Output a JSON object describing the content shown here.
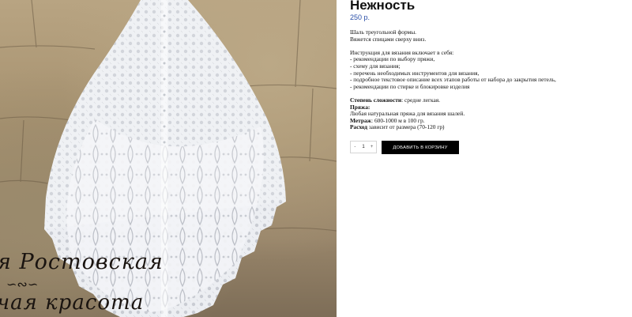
{
  "product": {
    "title": "Нежность",
    "price": "250 р.",
    "image_alt": "Шаль треугольной формы",
    "watermark_line1": "я Ростовская",
    "watermark_line2": "чая красота"
  },
  "description": {
    "intro_1": "Шаль треугольной формы.",
    "intro_2": "Вяжется спицами сверху вниз.",
    "includes_title": "Инструкция для вязания включает в себя:",
    "includes": [
      "- рекомендации по выбору пряжи,",
      "- схему для вязания;",
      "- перечень необходимых инструментов для вязания,",
      "- подробное текстовое описание всех этапов работы от набора до закрытия петель,",
      "- рекомендации по стирке и блокировке изделия"
    ],
    "difficulty_label": "Степень сложности",
    "difficulty_value": ": средне легкая.",
    "yarn_label": "Пряжа:",
    "yarn_value": "Любая натуральная пряжа для вязания шалей.",
    "meterage_label": "Метраж",
    "meterage_value": ": 600-1000 м в 100 гр.",
    "consumption_label": "Расход",
    "consumption_value": " зависит от размера (70-120 гр)"
  },
  "cart": {
    "minus": "-",
    "quantity": "1",
    "plus": "+",
    "add_button": "ДОБАВИТЬ В КОРЗИНУ"
  },
  "colors": {
    "price": "#2a4fa8",
    "button_bg": "#000000",
    "button_text": "#ffffff"
  }
}
